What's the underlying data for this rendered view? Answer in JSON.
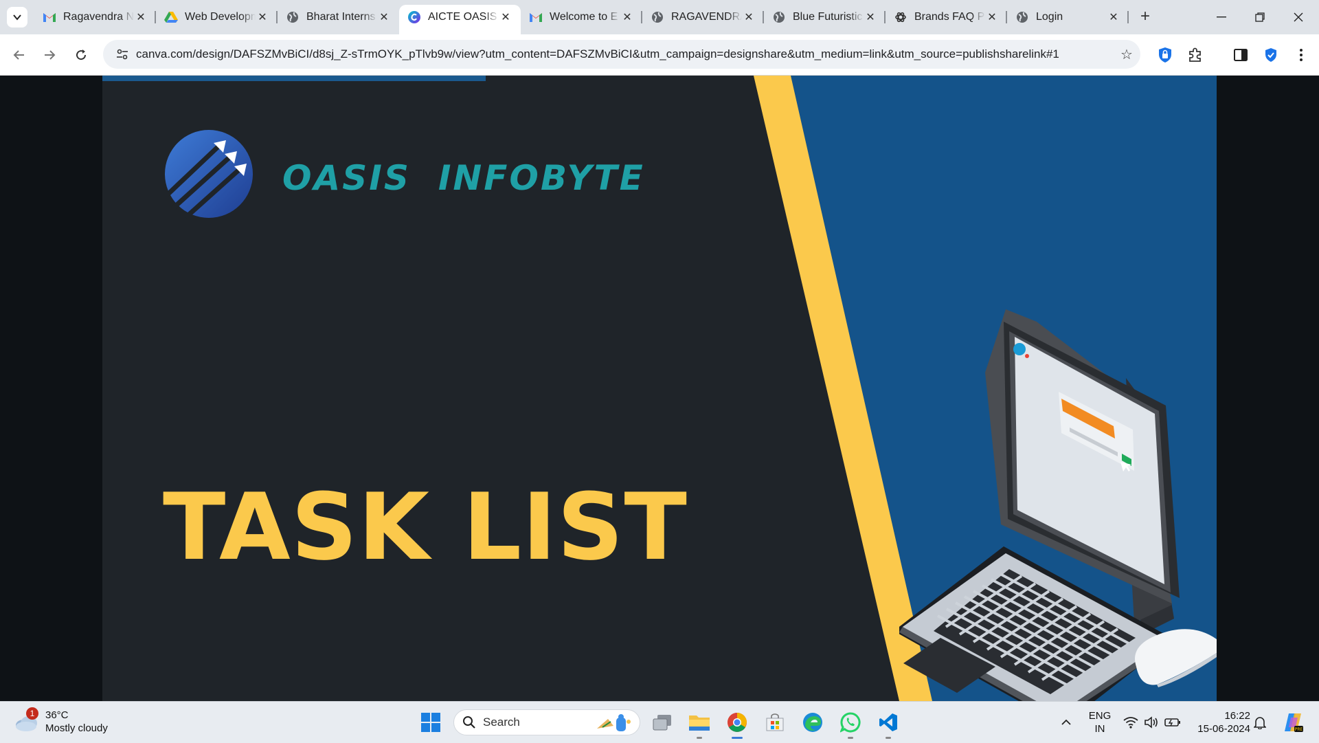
{
  "browser": {
    "tabs": [
      {
        "title": "Ragavendra N",
        "favicon": "gmail-icon"
      },
      {
        "title": "Web Developm",
        "favicon": "drive-icon"
      },
      {
        "title": "Bharat Interns",
        "favicon": "globe-icon"
      },
      {
        "title": "AICTE OASIS I",
        "favicon": "canva-icon",
        "active": true
      },
      {
        "title": "Welcome to E",
        "favicon": "gmail-icon"
      },
      {
        "title": "RAGAVENDRA",
        "favicon": "globe-icon"
      },
      {
        "title": "Blue Futuristic",
        "favicon": "globe-icon"
      },
      {
        "title": "Brands FAQ P",
        "favicon": "openai-icon"
      },
      {
        "title": "Login",
        "favicon": "globe-icon"
      }
    ],
    "address_url": "canva.com/design/DAFSZMvBiCI/d8sj_Z-sTrmOYK_pTlvb9w/view?utm_content=DAFSZMvBiCI&utm_campaign=designshare&utm_medium=link&utm_source=publishsharelink#1"
  },
  "slide": {
    "brand_word1": "OASIS",
    "brand_word2": "INFOBYTE",
    "title": "TASK LIST",
    "colors": {
      "background": "#1f2429",
      "accent_yellow": "#fbc94c",
      "panel_blue": "#14538a",
      "brand_teal": "#1fa0a6"
    }
  },
  "taskbar": {
    "weather_temp": "36°C",
    "weather_desc": "Mostly cloudy",
    "weather_badge": "1",
    "search_label": "Search",
    "language_line1": "ENG",
    "language_line2": "IN",
    "time": "16:22",
    "date": "15-06-2024"
  }
}
